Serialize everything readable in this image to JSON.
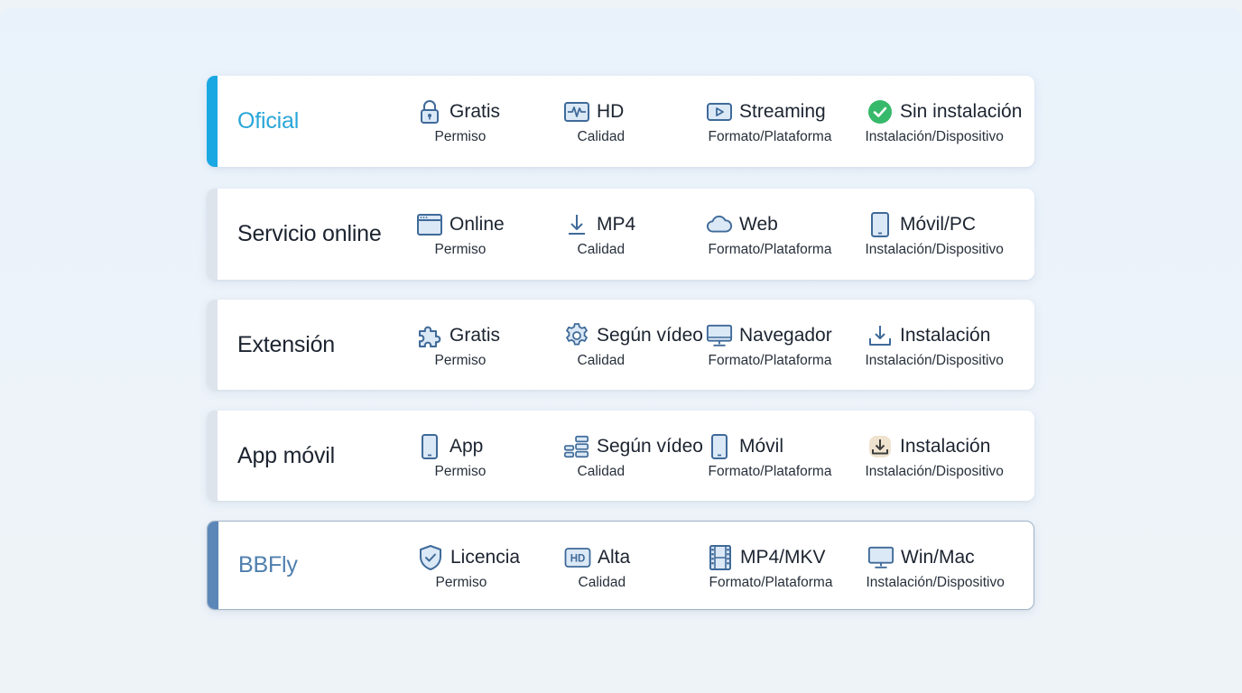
{
  "rows": [
    {
      "method": "Oficial",
      "method_color": "#2aa6d8",
      "accent_color": "#1aa8e3",
      "cells": [
        {
          "icon": "lock-icon",
          "value": "Gratis",
          "label": "Permiso"
        },
        {
          "icon": "waveform-icon",
          "value": "HD",
          "label": "Calidad"
        },
        {
          "icon": "play-icon",
          "value": "Streaming",
          "label": "Formato/Plataforma"
        },
        {
          "icon": "check-circle-icon",
          "value": "Sin instalación",
          "label": "Instalación/Dispositivo"
        }
      ]
    },
    {
      "method": "Servicio online",
      "method_color": "#1c2430",
      "accent_color": "#dde4ec",
      "cells": [
        {
          "icon": "browser-window-icon",
          "value": "Online",
          "label": "Permiso"
        },
        {
          "icon": "download-arrow-icon",
          "value": "MP4",
          "label": "Calidad"
        },
        {
          "icon": "cloud-icon",
          "value": "Web",
          "label": "Formato/Plataforma"
        },
        {
          "icon": "tablet-icon",
          "value": "Móvil/PC",
          "label": "Instalación/Dispositivo"
        }
      ]
    },
    {
      "method": "Extensión",
      "method_color": "#1c2430",
      "accent_color": "#dde4ec",
      "cells": [
        {
          "icon": "puzzle-icon",
          "value": "Gratis",
          "label": "Permiso"
        },
        {
          "icon": "gear-icon",
          "value": "Según vídeo",
          "label": "Calidad"
        },
        {
          "icon": "monitor-icon",
          "value": "Navegador",
          "label": "Formato/Plataforma"
        },
        {
          "icon": "install-tray-icon",
          "value": "Instalación",
          "label": "Instalación/Dispositivo"
        }
      ]
    },
    {
      "method": "App móvil",
      "method_color": "#1c2430",
      "accent_color": "#dde4ec",
      "cells": [
        {
          "icon": "phone-icon",
          "value": "App",
          "label": "Permiso"
        },
        {
          "icon": "list-bars-icon",
          "value": "Según vídeo",
          "label": "Calidad"
        },
        {
          "icon": "phone-icon",
          "value": "Móvil",
          "label": "Formato/Plataforma"
        },
        {
          "icon": "install-badge-icon",
          "value": "Instalación",
          "label": "Instalación/Dispositivo"
        }
      ]
    },
    {
      "method": "BBFly",
      "method_color": "#4f7fae",
      "accent_color": "#5b86b8",
      "cells": [
        {
          "icon": "shield-check-icon",
          "value": "Licencia",
          "label": "Permiso"
        },
        {
          "icon": "hd-badge-icon",
          "value": "Alta",
          "label": "Calidad"
        },
        {
          "icon": "film-icon",
          "value": "MP4/MKV",
          "label": "Formato/Plataforma"
        },
        {
          "icon": "desktop-icon",
          "value": "Win/Mac",
          "label": "Instalación/Dispositivo"
        }
      ]
    }
  ]
}
